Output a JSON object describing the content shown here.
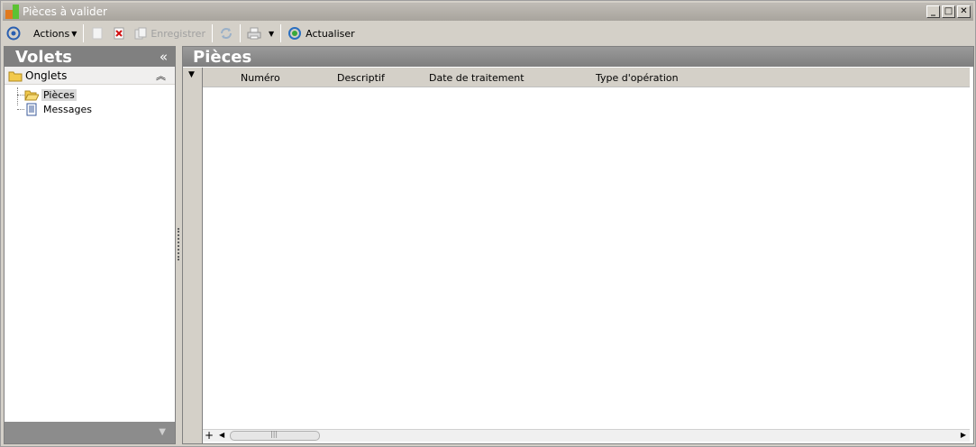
{
  "window": {
    "title": "Pièces à valider",
    "controls": [
      "_",
      "□",
      "✕"
    ]
  },
  "toolbar": {
    "actions_label": "Actions",
    "save_label": "Enregistrer",
    "refresh_label": "Actualiser",
    "icons": [
      "target-icon",
      "new-document-icon",
      "delete-icon",
      "copy-icon",
      "sync-icon",
      "print-icon",
      "refresh-icon"
    ]
  },
  "left_pane": {
    "title": "Volets",
    "collapse_glyph": "«",
    "section_label": "Onglets",
    "section_glyph": "⌃",
    "tree": [
      {
        "label": "Pièces",
        "icon": "open-folder-icon",
        "selected": true
      },
      {
        "label": "Messages",
        "icon": "document-icon",
        "selected": false
      }
    ]
  },
  "right_pane": {
    "title": "Pièces",
    "columns": [
      "Numéro",
      "Descriptif",
      "Date de traitement",
      "Type d'opération"
    ],
    "rows": []
  },
  "colors": {
    "title_bar": "#a8a49d",
    "pane_header": "#808080",
    "chrome": "#d4d0c8"
  }
}
